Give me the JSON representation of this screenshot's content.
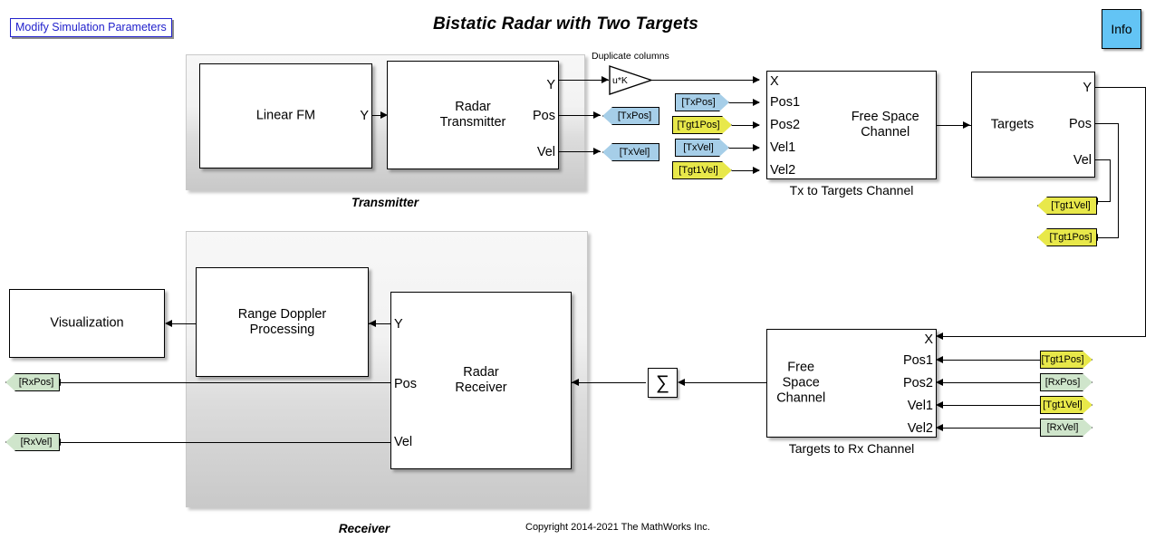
{
  "page": {
    "title": "Bistatic Radar with Two Targets",
    "copyright": "Copyright 2014-2021 The MathWorks Inc.",
    "param_button": "Modify Simulation Parameters",
    "info_button": "Info",
    "accent_blue": "#2222cc",
    "info_fill": "#63c4f5",
    "tag_blue": "#a6cee8",
    "tag_yellow": "#e8e84a",
    "tag_green": "#cfe5cb"
  },
  "transmitter": {
    "label": "Transmitter",
    "linear_fm": {
      "name": "Linear FM",
      "out_port": "Y"
    },
    "radar_tx": {
      "name": "Radar\nTransmitter",
      "out_y": "Y",
      "out_pos": "Pos",
      "out_vel": "Vel"
    }
  },
  "gain": {
    "expr": "u*K",
    "note": "Duplicate columns"
  },
  "tx_to_targets": {
    "name": "Free Space\nChannel",
    "caption": "Tx to Targets Channel",
    "ports": [
      "X",
      "Pos1",
      "Pos2",
      "Vel1",
      "Vel2"
    ]
  },
  "targets": {
    "name": "Targets",
    "out_y": "Y",
    "out_pos": "Pos",
    "out_vel": "Vel"
  },
  "targets_to_rx": {
    "name": "Free Space\nChannel",
    "caption": "Targets to Rx Channel",
    "ports": [
      "X",
      "Pos1",
      "Pos2",
      "Vel1",
      "Vel2"
    ]
  },
  "receiver": {
    "label": "Receiver",
    "range_doppler": {
      "name": "Range Doppler\nProcessing"
    },
    "radar_rx": {
      "name": "Radar\nReceiver",
      "in_y": "Y",
      "in_pos": "Pos",
      "in_vel": "Vel"
    },
    "visualization": {
      "name": "Visualization"
    },
    "sum_symbol": "∑"
  },
  "tags": {
    "tx_pos_goto": "[TxPos]",
    "tx_vel_goto": "[TxVel]",
    "tx_pos_from": "[TxPos]",
    "tx_vel_from": "[TxVel]",
    "tgt1_pos_from_top": "[Tgt1Pos]",
    "tgt1_vel_from_top": "[Tgt1Vel]",
    "tgt1_vel_goto": "[Tgt1Vel]",
    "tgt1_pos_goto": "[Tgt1Pos]",
    "rx_pos_goto": "[RxPos]",
    "rx_vel_goto": "[RxVel]",
    "tgt1_pos_from_bot": "[Tgt1Pos]",
    "rx_pos_from": "[RxPos]",
    "tgt1_vel_from_bot": "[Tgt1Vel]",
    "rx_vel_from": "[RxVel]"
  }
}
